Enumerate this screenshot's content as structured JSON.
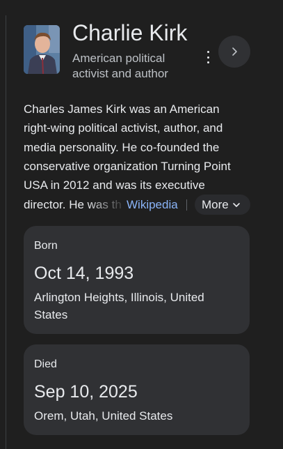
{
  "entity": {
    "name": "Charlie Kirk",
    "subtitle": "American political activist and author",
    "thumbnail_icon": "portrait-photo"
  },
  "description": {
    "lines": [
      "Charles James Kirk was an American",
      "right-wing political activist, author, and",
      "media personality. He co-founded the",
      "conservative organization Turning Point",
      "USA in 2012 and was its executive"
    ],
    "faded_line": "director. He was th",
    "source_link": "Wikipedia",
    "more_label": "More"
  },
  "facts": {
    "born": {
      "label": "Born",
      "date": "Oct 14, 1993",
      "place": "Arlington Heights, Illinois, United States"
    },
    "died": {
      "label": "Died",
      "date": "Sep 10, 2025",
      "place": "Orem, Utah, United States"
    }
  },
  "colors": {
    "background": "#1f1f1f",
    "card": "#303134",
    "link": "#8ab4f8",
    "text": "#e8eaed",
    "muted": "#bdc1c6"
  },
  "icons": {
    "menu": "more-vert-icon",
    "next": "chevron-right-icon",
    "more": "chevron-down-icon"
  }
}
